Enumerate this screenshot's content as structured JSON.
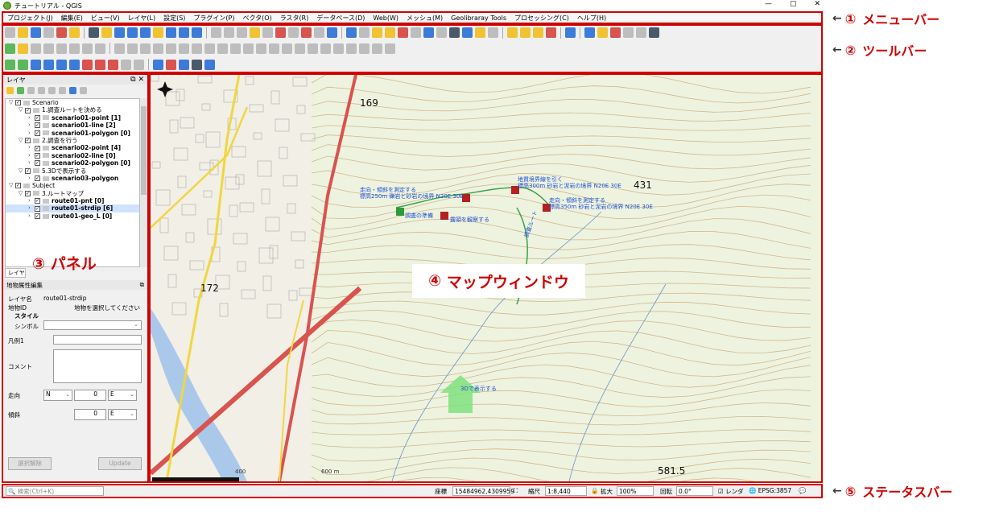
{
  "window": {
    "title": "チュートリアル - QGIS",
    "controls": [
      "—",
      "▢",
      "✕"
    ]
  },
  "menu": [
    "プロジェクト(J)",
    "編集(E)",
    "ビュー(V)",
    "レイヤ(L)",
    "設定(S)",
    "プラグイン(P)",
    "ベクタ(O)",
    "ラスタ(R)",
    "データベース(D)",
    "Web(W)",
    "メッシュ(M)",
    "Geolibraray Tools",
    "プロセッシング(C)",
    "ヘルプ(H)"
  ],
  "layers_panel": {
    "title": "レイヤ",
    "items": [
      {
        "indent": 0,
        "expand": "▽",
        "checked": true,
        "text": "Scenario",
        "bold": false,
        "icon": "group"
      },
      {
        "indent": 1,
        "expand": "▽",
        "checked": true,
        "text": "1.調査ルートを決める",
        "bold": false,
        "icon": "group"
      },
      {
        "indent": 2,
        "expand": "›",
        "checked": true,
        "text": "scenario01-point [1]",
        "bold": true,
        "icon": "point"
      },
      {
        "indent": 2,
        "expand": "›",
        "checked": true,
        "text": "scenario01-line [2]",
        "bold": true,
        "icon": "line"
      },
      {
        "indent": 2,
        "expand": "›",
        "checked": true,
        "text": "scenario01-polygon [0]",
        "bold": true,
        "icon": "polygon"
      },
      {
        "indent": 1,
        "expand": "▽",
        "checked": true,
        "text": "2.調査を行う",
        "bold": false,
        "icon": "group"
      },
      {
        "indent": 2,
        "expand": "›",
        "checked": true,
        "text": "scenario02-point [4]",
        "bold": true,
        "icon": "point"
      },
      {
        "indent": 2,
        "expand": "›",
        "checked": true,
        "text": "scenario02-line [0]",
        "bold": true,
        "icon": "line"
      },
      {
        "indent": 2,
        "expand": "›",
        "checked": true,
        "text": "scenario02-polygon [0]",
        "bold": true,
        "icon": "polygon"
      },
      {
        "indent": 1,
        "expand": "▽",
        "checked": true,
        "text": "5.3Dで表示する",
        "bold": false,
        "icon": "group"
      },
      {
        "indent": 2,
        "expand": "›",
        "checked": true,
        "text": "scenario03-polygon",
        "bold": true,
        "icon": "polygon"
      },
      {
        "indent": 0,
        "expand": "▽",
        "checked": true,
        "text": "Subject",
        "bold": false,
        "icon": "group"
      },
      {
        "indent": 1,
        "expand": "▽",
        "checked": true,
        "text": "3.ルートマップ",
        "bold": false,
        "icon": "group"
      },
      {
        "indent": 2,
        "expand": "›",
        "checked": true,
        "text": "route01-pnt [0]",
        "bold": true,
        "icon": "point"
      },
      {
        "indent": 2,
        "expand": "›",
        "checked": true,
        "text": "route01-strdip [6]",
        "bold": true,
        "icon": "point",
        "selected": true
      },
      {
        "indent": 2,
        "expand": "›",
        "checked": true,
        "text": "route01-geo_L [0]",
        "bold": true,
        "icon": "line"
      }
    ],
    "tab_label": "レイヤ"
  },
  "attr_panel": {
    "title": "地物属性編集",
    "layer_name_label": "レイヤ名",
    "layer_name_value": "route01-strdip",
    "feature_id_label": "地物ID",
    "feature_id_value": "地物を選択してください",
    "style_label": "スタイル",
    "symbol_label": "シンボル",
    "legend_label": "凡例1",
    "comment_label": "コメント",
    "strike_label": "走向",
    "strike_dir": "N",
    "strike_value": "0",
    "strike_dir2": "E",
    "dip_label": "傾斜",
    "dip_value": "0",
    "dip_dir": "E",
    "clear_button": "選択解除",
    "update_button": "Update"
  },
  "map": {
    "numbers": [
      "169",
      "431",
      "172",
      "581.5",
      "400",
      "600 m"
    ],
    "labels": [
      "走向・傾斜を測定する",
      "標高250m 礫岩と砂岩の境界 N20E 30E",
      "調査の準備",
      "露頭を観察する",
      "地質境界線を引く",
      "標高300m 砂岩と泥岩の境界 N20E 30E",
      "走向・傾斜を測定する",
      "標高350m 砂岩と泥岩の境界 N20E 30E",
      "調査ルート",
      "3Dで表示する"
    ]
  },
  "statusbar": {
    "search_placeholder": "検索(Ctrl+K)",
    "coord_label": "座標",
    "coord_value": "15484962,4309959",
    "scale_label": "縮尺",
    "scale_value": "1:8,440",
    "magnifier_label": "拡大",
    "magnifier_value": "100%",
    "rotation_label": "回転",
    "rotation_value": "0.0°",
    "render_label": "レンダ",
    "crs": "EPSG:3857"
  },
  "callouts": [
    {
      "num": "①",
      "text": "メニューバー"
    },
    {
      "num": "②",
      "text": "ツールバー"
    },
    {
      "num": "③",
      "text": "パネル"
    },
    {
      "num": "④",
      "text": "マップウィンドウ"
    },
    {
      "num": "⑤",
      "text": "ステータスバー"
    }
  ],
  "colors": {
    "callout": "#d00000",
    "label_blue": "#1a4fd6",
    "road_red": "#d9534f",
    "road_yellow": "#f1d640",
    "contour": "#c9a878"
  }
}
